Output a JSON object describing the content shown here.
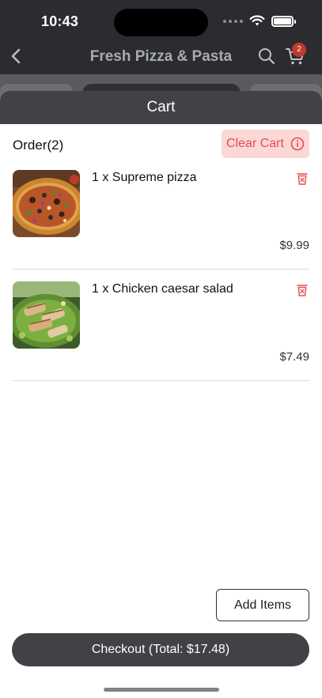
{
  "status_bar": {
    "time": "10:43"
  },
  "app_header": {
    "title": "Fresh Pizza & Pasta",
    "cart_count": "2"
  },
  "sheet": {
    "title": "Cart"
  },
  "order": {
    "title": "Order(2)",
    "clear_label": "Clear Cart"
  },
  "items": [
    {
      "name": "1 x Supreme pizza",
      "price": "$9.99"
    },
    {
      "name": "1 x Chicken caesar salad",
      "price": "$7.49"
    }
  ],
  "actions": {
    "add_items_label": "Add Items",
    "checkout_label": "Checkout (Total: $17.48)"
  },
  "colors": {
    "header_bg": "#2a2c2f",
    "sheet_header_bg": "#404245",
    "danger": "#e74c4c",
    "danger_bg": "#fbd7d6"
  },
  "icons": {
    "back": "chevron-left-icon",
    "search": "search-icon",
    "cart": "cart-icon",
    "info": "info-icon",
    "trash": "trash-icon"
  }
}
